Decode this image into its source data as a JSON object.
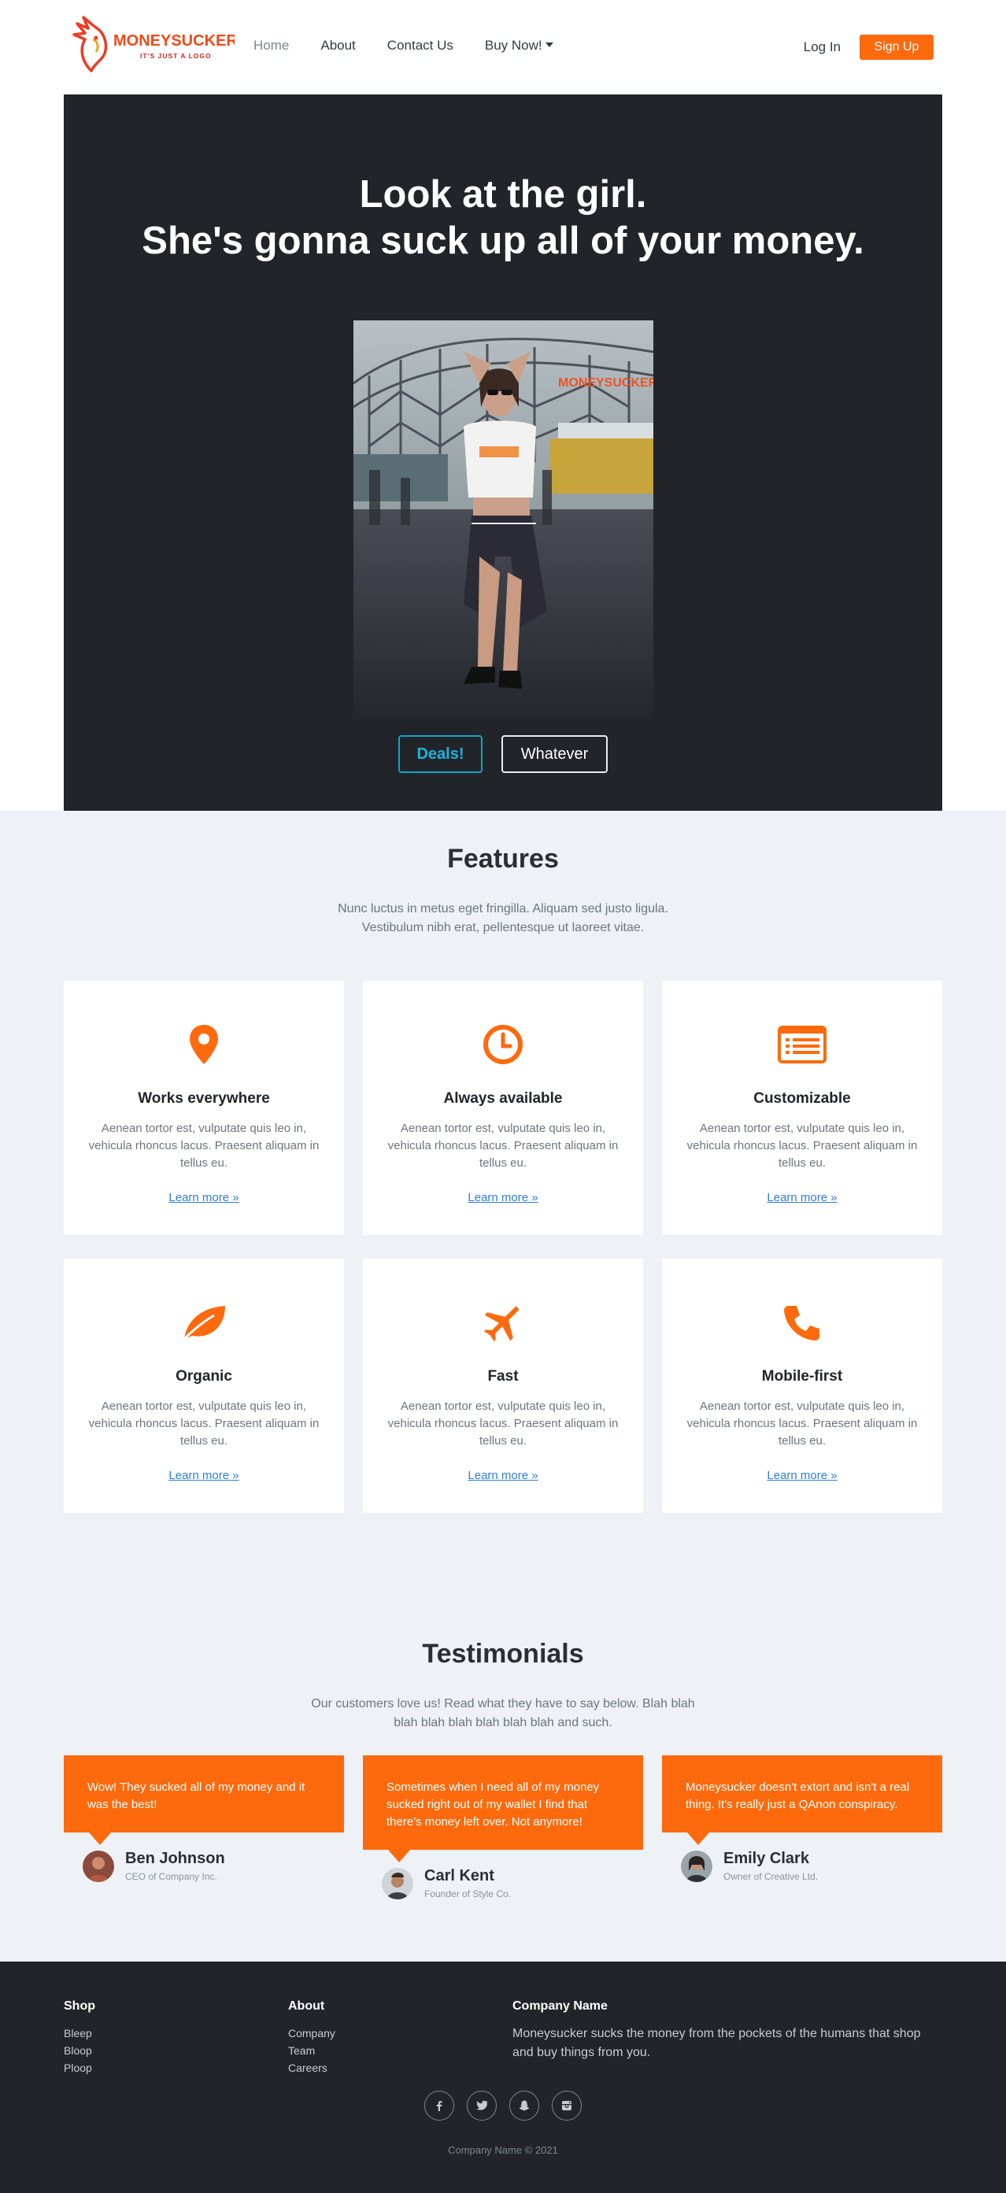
{
  "colors": {
    "accent": "#fd6a0d",
    "dark": "#212529",
    "section_bg": "#eef2f6",
    "link": "#2f7ed8",
    "info": "#19b4dc"
  },
  "brand": {
    "logo_text": "MONEYSUCKER",
    "logo_tagline": "IT'S JUST A LOGO"
  },
  "nav": {
    "links": [
      {
        "label": "Home",
        "active": true
      },
      {
        "label": "About"
      },
      {
        "label": "Contact Us"
      },
      {
        "label": "Buy Now!",
        "dropdown": true
      }
    ],
    "login_label": "Log In",
    "signup_label": "Sign Up"
  },
  "hero": {
    "title_line1": "Look at the girl.",
    "title_line2": "She's gonna suck up all of your money.",
    "primary_button": "Deals!",
    "secondary_button": "Whatever"
  },
  "features": {
    "title": "Features",
    "lead": "Nunc luctus in metus eget fringilla. Aliquam sed justo ligula. Vestibulum nibh erat, pellentesque ut laoreet vitae.",
    "items": [
      {
        "icon": "map-pin-icon",
        "title": "Works everywhere",
        "text": "Aenean tortor est, vulputate quis leo in, vehicula rhoncus lacus. Praesent aliquam in tellus eu.",
        "link": "Learn more »"
      },
      {
        "icon": "clock-icon",
        "title": "Always available",
        "text": "Aenean tortor est, vulputate quis leo in, vehicula rhoncus lacus. Praesent aliquam in tellus eu.",
        "link": "Learn more »"
      },
      {
        "icon": "list-card-icon",
        "title": "Customizable",
        "text": "Aenean tortor est, vulputate quis leo in, vehicula rhoncus lacus. Praesent aliquam in tellus eu.",
        "link": "Learn more »"
      },
      {
        "icon": "leaf-icon",
        "title": "Organic",
        "text": "Aenean tortor est, vulputate quis leo in, vehicula rhoncus lacus. Praesent aliquam in tellus eu.",
        "link": "Learn more »"
      },
      {
        "icon": "airplane-icon",
        "title": "Fast",
        "text": "Aenean tortor est, vulputate quis leo in, vehicula rhoncus lacus. Praesent aliquam in tellus eu.",
        "link": "Learn more »"
      },
      {
        "icon": "phone-icon",
        "title": "Mobile-first",
        "text": "Aenean tortor est, vulputate quis leo in, vehicula rhoncus lacus. Praesent aliquam in tellus eu.",
        "link": "Learn more »"
      }
    ]
  },
  "testimonials": {
    "title": "Testimonials",
    "lead": "Our customers love us! Read what they have to say below. Blah blah blah blah blah blah blah blah and such.",
    "items": [
      {
        "quote": "Wow! They sucked all of my money and it was the best!",
        "name": "Ben Johnson",
        "role": "CEO of Company Inc."
      },
      {
        "quote": "Sometimes when I need all of my money sucked right out of my wallet I find that there's money left over. Not anymore!",
        "name": "Carl Kent",
        "role": "Founder of Style Co."
      },
      {
        "quote": "Moneysucker doesn't extort and isn't a real thing. It's really just a QAnon conspiracy.",
        "name": "Emily Clark",
        "role": "Owner of Creative Ltd."
      }
    ]
  },
  "footer": {
    "shop": {
      "heading": "Shop",
      "links": [
        "Bleep",
        "Bloop",
        "Ploop"
      ]
    },
    "about": {
      "heading": "About",
      "links": [
        "Company",
        "Team",
        "Careers"
      ]
    },
    "company": {
      "heading": "Company Name",
      "text": "Moneysucker sucks the money from the pockets of the humans that shop and buy things from you."
    },
    "socials": [
      "facebook-icon",
      "twitter-icon",
      "snapchat-icon",
      "instagram-icon"
    ],
    "copyright": "Company Name © 2021"
  }
}
